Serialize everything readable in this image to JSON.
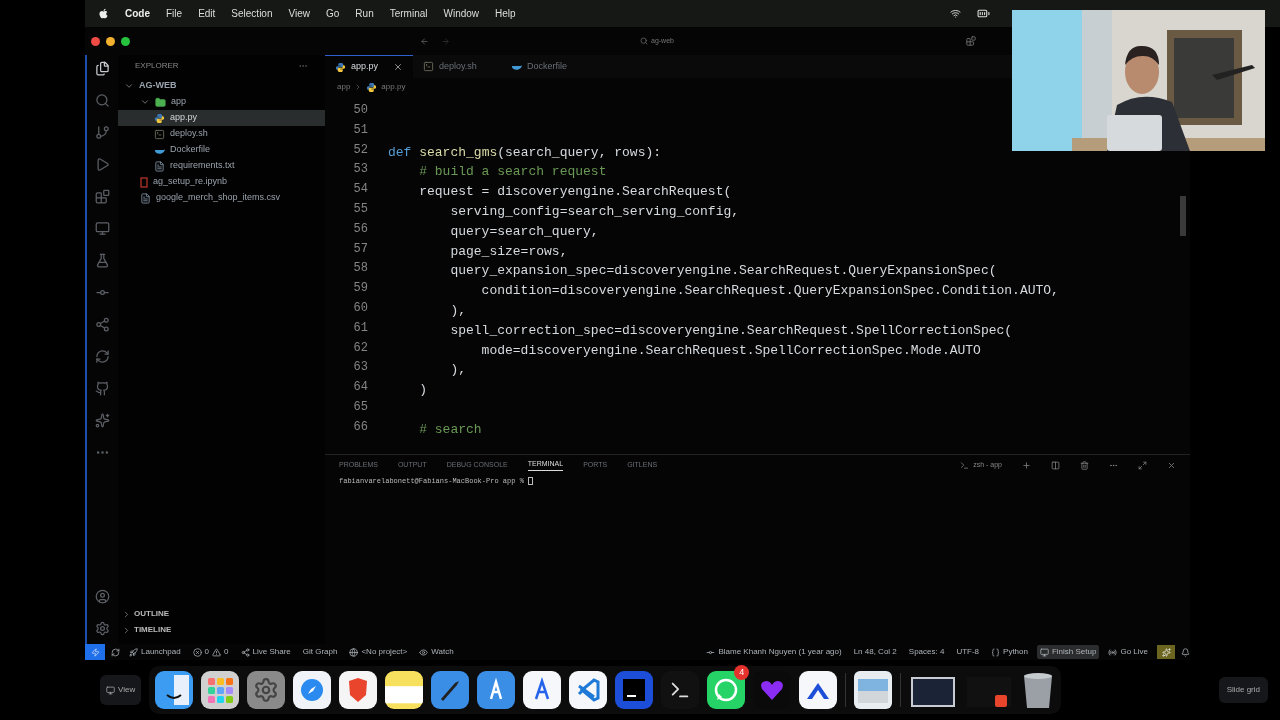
{
  "menu_bar": {
    "app": "Code",
    "items": [
      "File",
      "Edit",
      "Selection",
      "View",
      "Go",
      "Run",
      "Terminal",
      "Window",
      "Help"
    ]
  },
  "title_bar": {
    "search": "ag-web"
  },
  "explorer": {
    "title": "EXPLORER",
    "tree": [
      {
        "label": "AG-WEB",
        "kind": "root",
        "expanded": true,
        "selected": false,
        "children": [
          {
            "label": "app",
            "kind": "folder",
            "expanded": true,
            "selected": false,
            "children": [
              {
                "label": "app.py",
                "kind": "python",
                "selected": true
              },
              {
                "label": "deploy.sh",
                "kind": "shell",
                "selected": false
              },
              {
                "label": "Dockerfile",
                "kind": "docker",
                "selected": false
              },
              {
                "label": "requirements.txt",
                "kind": "text",
                "selected": false
              }
            ]
          },
          {
            "label": "ag_setup_re.ipynb",
            "kind": "notebook",
            "selected": false
          },
          {
            "label": "google_merch_shop_items.csv",
            "kind": "text",
            "selected": false
          }
        ]
      }
    ],
    "sections": [
      {
        "label": "OUTLINE",
        "expanded": false
      },
      {
        "label": "TIMELINE",
        "expanded": false
      }
    ]
  },
  "tabs": [
    {
      "label": "app.py",
      "kind": "python",
      "selected": true
    },
    {
      "label": "deploy.sh",
      "kind": "shell",
      "selected": false
    },
    {
      "label": "Dockerfile",
      "kind": "docker",
      "selected": false
    }
  ],
  "breadcrumbs": [
    "app",
    "app.py"
  ],
  "code": [
    {
      "number": "50"
    },
    {
      "number": "51"
    },
    {
      "number": "52",
      "segments": [
        {
          "kind": "keyword",
          "text": "def "
        },
        {
          "kind": "function",
          "text": "search_gms"
        },
        {
          "kind": "plain",
          "text": "(search_query, rows):"
        }
      ]
    },
    {
      "number": "53",
      "segments": [
        {
          "kind": "comment",
          "text": "    # build a search request"
        }
      ]
    },
    {
      "number": "54",
      "segments": [
        {
          "kind": "plain",
          "text": "    request = discoveryengine.SearchRequest("
        }
      ]
    },
    {
      "number": "55",
      "segments": [
        {
          "kind": "plain",
          "text": "        serving_config=search_serving_config,"
        }
      ]
    },
    {
      "number": "56",
      "segments": [
        {
          "kind": "plain",
          "text": "        query=search_query,"
        }
      ]
    },
    {
      "number": "57",
      "segments": [
        {
          "kind": "plain",
          "text": "        page_size=rows,"
        }
      ]
    },
    {
      "number": "58",
      "segments": [
        {
          "kind": "plain",
          "text": "        query_expansion_spec=discoveryengine.SearchRequest.QueryExpansionSpec("
        }
      ]
    },
    {
      "number": "59",
      "segments": [
        {
          "kind": "plain",
          "text": "            condition=discoveryengine.SearchRequest.QueryExpansionSpec.Condition.AUTO,"
        }
      ]
    },
    {
      "number": "60",
      "segments": [
        {
          "kind": "plain",
          "text": "        ),"
        }
      ]
    },
    {
      "number": "61",
      "segments": [
        {
          "kind": "plain",
          "text": "        spell_correction_spec=discoveryengine.SearchRequest.SpellCorrectionSpec("
        }
      ]
    },
    {
      "number": "62",
      "segments": [
        {
          "kind": "plain",
          "text": "            mode=discoveryengine.SearchRequest.SpellCorrectionSpec.Mode.AUTO"
        }
      ]
    },
    {
      "number": "63",
      "segments": [
        {
          "kind": "plain",
          "text": "        ),"
        }
      ]
    },
    {
      "number": "64",
      "segments": [
        {
          "kind": "plain",
          "text": "    )"
        }
      ]
    },
    {
      "number": "65"
    },
    {
      "number": "66",
      "segments": [
        {
          "kind": "comment",
          "text": "    # search"
        }
      ]
    }
  ],
  "panel": {
    "tabs": [
      {
        "label": "PROBLEMS",
        "selected": false
      },
      {
        "label": "OUTPUT",
        "selected": false
      },
      {
        "label": "DEBUG CONSOLE",
        "selected": false
      },
      {
        "label": "TERMINAL",
        "selected": true
      },
      {
        "label": "PORTS",
        "selected": false
      },
      {
        "label": "GITLENS",
        "selected": false
      }
    ],
    "shell": "zsh - app",
    "prompt": "fabianvarelabonett@Fabians-MacBook-Pro app %"
  },
  "status_bar": {
    "left": [
      {
        "kind": "remote"
      },
      {
        "kind": "sync"
      },
      {
        "kind": "launchpad",
        "text": "Launchpad"
      },
      {
        "kind": "problems",
        "errors": "0",
        "warnings": "0"
      },
      {
        "kind": "liveshare",
        "text": "Live Share"
      },
      {
        "kind": "plain",
        "text": "Git Graph"
      },
      {
        "kind": "project",
        "text": "<No project>"
      },
      {
        "kind": "watch",
        "text": "Watch"
      }
    ],
    "right": [
      {
        "kind": "blame",
        "text": "Blame Khanh Nguyen (1 year ago)"
      },
      {
        "kind": "plain",
        "text": "Ln 48, Col 2"
      },
      {
        "kind": "plain",
        "text": "Spaces: 4"
      },
      {
        "kind": "plain",
        "text": "UTF-8"
      },
      {
        "kind": "language",
        "text": "Python"
      },
      {
        "kind": "setup",
        "text": "Finish Setup"
      },
      {
        "kind": "golive",
        "text": "Go Live"
      },
      {
        "kind": "alert"
      },
      {
        "kind": "bell"
      }
    ]
  },
  "dock": {
    "view_button": "View",
    "badge": "4",
    "slide_button": "Slide grid"
  },
  "webcam": {
    "kind": "picture"
  }
}
